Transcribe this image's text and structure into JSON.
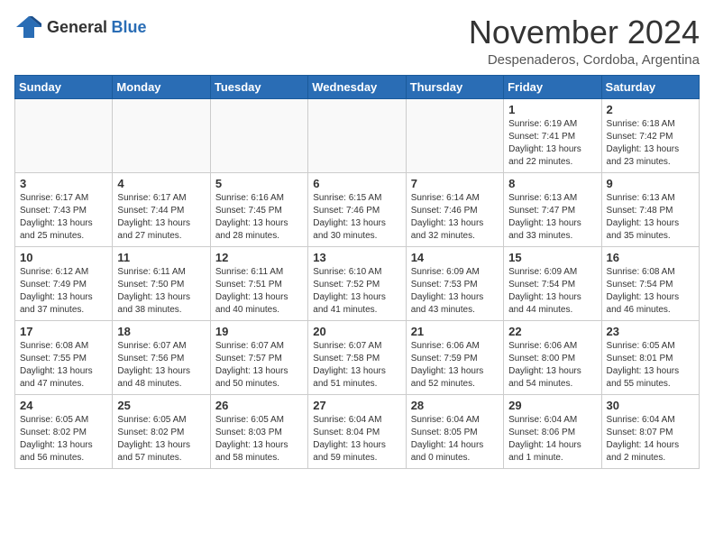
{
  "header": {
    "logo_general": "General",
    "logo_blue": "Blue",
    "month_title": "November 2024",
    "location": "Despenaderos, Cordoba, Argentina"
  },
  "weekdays": [
    "Sunday",
    "Monday",
    "Tuesday",
    "Wednesday",
    "Thursday",
    "Friday",
    "Saturday"
  ],
  "weeks": [
    [
      {
        "day": "",
        "info": ""
      },
      {
        "day": "",
        "info": ""
      },
      {
        "day": "",
        "info": ""
      },
      {
        "day": "",
        "info": ""
      },
      {
        "day": "",
        "info": ""
      },
      {
        "day": "1",
        "info": "Sunrise: 6:19 AM\nSunset: 7:41 PM\nDaylight: 13 hours\nand 22 minutes."
      },
      {
        "day": "2",
        "info": "Sunrise: 6:18 AM\nSunset: 7:42 PM\nDaylight: 13 hours\nand 23 minutes."
      }
    ],
    [
      {
        "day": "3",
        "info": "Sunrise: 6:17 AM\nSunset: 7:43 PM\nDaylight: 13 hours\nand 25 minutes."
      },
      {
        "day": "4",
        "info": "Sunrise: 6:17 AM\nSunset: 7:44 PM\nDaylight: 13 hours\nand 27 minutes."
      },
      {
        "day": "5",
        "info": "Sunrise: 6:16 AM\nSunset: 7:45 PM\nDaylight: 13 hours\nand 28 minutes."
      },
      {
        "day": "6",
        "info": "Sunrise: 6:15 AM\nSunset: 7:46 PM\nDaylight: 13 hours\nand 30 minutes."
      },
      {
        "day": "7",
        "info": "Sunrise: 6:14 AM\nSunset: 7:46 PM\nDaylight: 13 hours\nand 32 minutes."
      },
      {
        "day": "8",
        "info": "Sunrise: 6:13 AM\nSunset: 7:47 PM\nDaylight: 13 hours\nand 33 minutes."
      },
      {
        "day": "9",
        "info": "Sunrise: 6:13 AM\nSunset: 7:48 PM\nDaylight: 13 hours\nand 35 minutes."
      }
    ],
    [
      {
        "day": "10",
        "info": "Sunrise: 6:12 AM\nSunset: 7:49 PM\nDaylight: 13 hours\nand 37 minutes."
      },
      {
        "day": "11",
        "info": "Sunrise: 6:11 AM\nSunset: 7:50 PM\nDaylight: 13 hours\nand 38 minutes."
      },
      {
        "day": "12",
        "info": "Sunrise: 6:11 AM\nSunset: 7:51 PM\nDaylight: 13 hours\nand 40 minutes."
      },
      {
        "day": "13",
        "info": "Sunrise: 6:10 AM\nSunset: 7:52 PM\nDaylight: 13 hours\nand 41 minutes."
      },
      {
        "day": "14",
        "info": "Sunrise: 6:09 AM\nSunset: 7:53 PM\nDaylight: 13 hours\nand 43 minutes."
      },
      {
        "day": "15",
        "info": "Sunrise: 6:09 AM\nSunset: 7:54 PM\nDaylight: 13 hours\nand 44 minutes."
      },
      {
        "day": "16",
        "info": "Sunrise: 6:08 AM\nSunset: 7:54 PM\nDaylight: 13 hours\nand 46 minutes."
      }
    ],
    [
      {
        "day": "17",
        "info": "Sunrise: 6:08 AM\nSunset: 7:55 PM\nDaylight: 13 hours\nand 47 minutes."
      },
      {
        "day": "18",
        "info": "Sunrise: 6:07 AM\nSunset: 7:56 PM\nDaylight: 13 hours\nand 48 minutes."
      },
      {
        "day": "19",
        "info": "Sunrise: 6:07 AM\nSunset: 7:57 PM\nDaylight: 13 hours\nand 50 minutes."
      },
      {
        "day": "20",
        "info": "Sunrise: 6:07 AM\nSunset: 7:58 PM\nDaylight: 13 hours\nand 51 minutes."
      },
      {
        "day": "21",
        "info": "Sunrise: 6:06 AM\nSunset: 7:59 PM\nDaylight: 13 hours\nand 52 minutes."
      },
      {
        "day": "22",
        "info": "Sunrise: 6:06 AM\nSunset: 8:00 PM\nDaylight: 13 hours\nand 54 minutes."
      },
      {
        "day": "23",
        "info": "Sunrise: 6:05 AM\nSunset: 8:01 PM\nDaylight: 13 hours\nand 55 minutes."
      }
    ],
    [
      {
        "day": "24",
        "info": "Sunrise: 6:05 AM\nSunset: 8:02 PM\nDaylight: 13 hours\nand 56 minutes."
      },
      {
        "day": "25",
        "info": "Sunrise: 6:05 AM\nSunset: 8:02 PM\nDaylight: 13 hours\nand 57 minutes."
      },
      {
        "day": "26",
        "info": "Sunrise: 6:05 AM\nSunset: 8:03 PM\nDaylight: 13 hours\nand 58 minutes."
      },
      {
        "day": "27",
        "info": "Sunrise: 6:04 AM\nSunset: 8:04 PM\nDaylight: 13 hours\nand 59 minutes."
      },
      {
        "day": "28",
        "info": "Sunrise: 6:04 AM\nSunset: 8:05 PM\nDaylight: 14 hours\nand 0 minutes."
      },
      {
        "day": "29",
        "info": "Sunrise: 6:04 AM\nSunset: 8:06 PM\nDaylight: 14 hours\nand 1 minute."
      },
      {
        "day": "30",
        "info": "Sunrise: 6:04 AM\nSunset: 8:07 PM\nDaylight: 14 hours\nand 2 minutes."
      }
    ]
  ]
}
